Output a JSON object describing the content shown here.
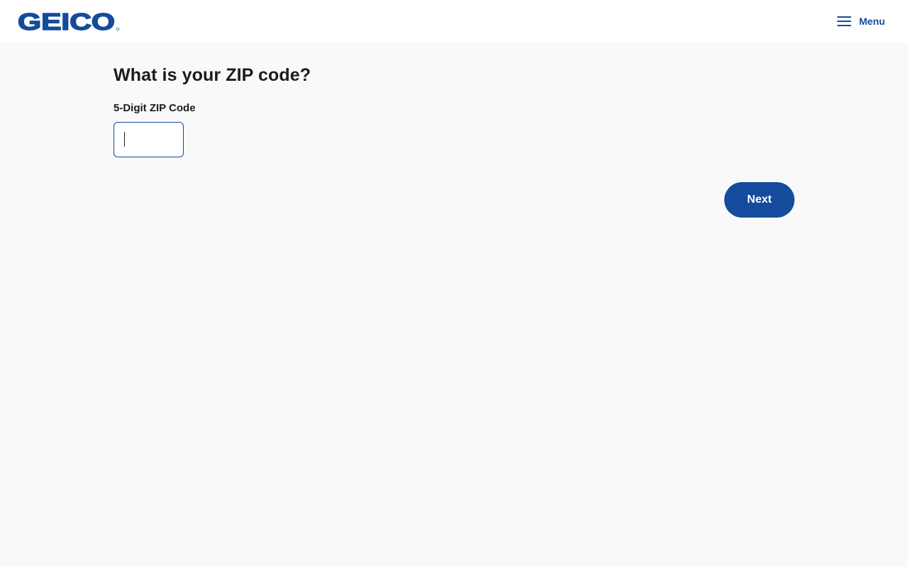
{
  "brand": {
    "logo_text": "GEICO",
    "primary_color": "#154b9c"
  },
  "header": {
    "menu_label": "Menu",
    "menu_icon": "hamburger-icon"
  },
  "form": {
    "title": "What is your ZIP code?",
    "zip_label": "5-Digit ZIP Code",
    "zip_value": "",
    "zip_placeholder": "",
    "next_label": "Next"
  }
}
